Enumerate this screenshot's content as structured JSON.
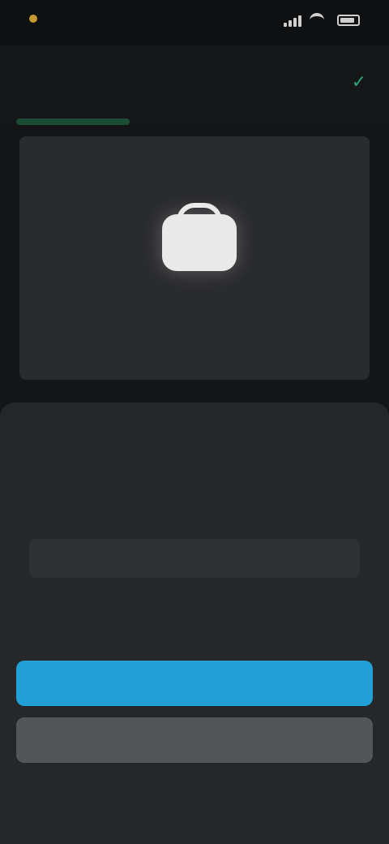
{
  "status_bar": {
    "time": "",
    "battery_text": "",
    "icons": [
      "signal-icon",
      "wifi-icon",
      "battery-icon"
    ]
  },
  "header": {
    "title": "",
    "action_icon": "check-icon"
  },
  "preview": {
    "icon": "briefcase-icon",
    "caption": ""
  },
  "sheet": {
    "title": "",
    "picker_items": [
      "",
      "",
      "",
      "",
      ""
    ],
    "selected_index": 2,
    "primary_button_label": "",
    "secondary_button_label": ""
  },
  "colors": {
    "primary": "#20a0d6",
    "secondary": "#545556",
    "accent": "#2fa37b",
    "background": "#141516",
    "sheet": "#262729"
  }
}
